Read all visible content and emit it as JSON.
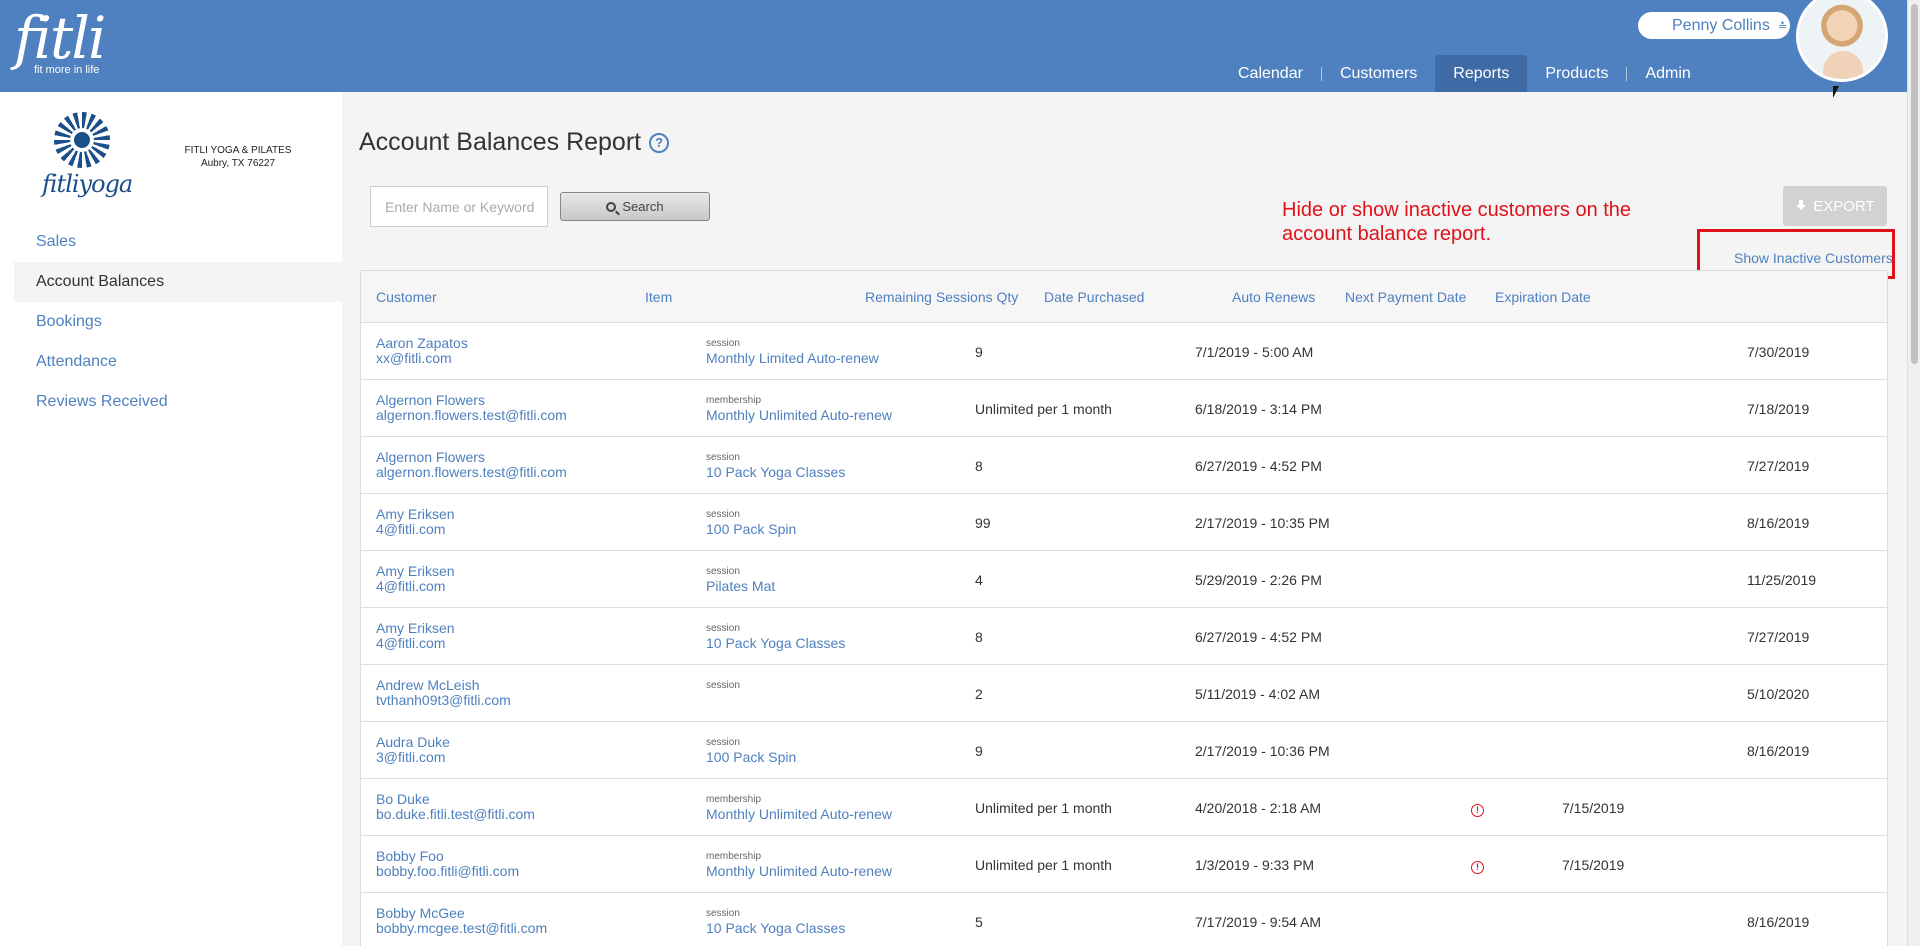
{
  "header": {
    "logo_text": "fitli",
    "logo_tagline": "fit more in life",
    "user_name": "Penny Collins",
    "nav": [
      {
        "label": "Calendar",
        "active": false
      },
      {
        "label": "Customers",
        "active": false
      },
      {
        "label": "Reports",
        "active": true
      },
      {
        "label": "Products",
        "active": false
      },
      {
        "label": "Admin",
        "active": false
      }
    ]
  },
  "sidebar": {
    "logo_text": "fitliyoga",
    "business_name": "FITLI YOGA & PILATES",
    "business_location": "Aubry, TX 76227",
    "items": [
      {
        "label": "Sales",
        "active": false
      },
      {
        "label": "Account Balances",
        "active": true
      },
      {
        "label": "Bookings",
        "active": false
      },
      {
        "label": "Attendance",
        "active": false
      },
      {
        "label": "Reviews Received",
        "active": false
      }
    ]
  },
  "main": {
    "title": "Account Balances Report",
    "help_glyph": "?",
    "search_placeholder": "Enter Name or Keyword",
    "search_label": "Search",
    "export_label": "EXPORT",
    "annotation": "Hide or show inactive customers on the account balance report.",
    "show_inactive_label": "Show Inactive Customers"
  },
  "table": {
    "columns": [
      "Customer",
      "Item",
      "Remaining Sessions Qty",
      "Date Purchased",
      "Auto Renews",
      "Next Payment Date",
      "Expiration Date"
    ],
    "rows": [
      {
        "name": "Aaron Zapatos",
        "email": "xx@fitli.com",
        "item_type": "session",
        "item_name": "Monthly Limited Auto-renew",
        "qty": "9",
        "date": "7/1/2019 - 5:00 AM",
        "auto_renew_warning": false,
        "next_payment": "",
        "expiration": "7/30/2019"
      },
      {
        "name": "Algernon Flowers",
        "email": "algernon.flowers.test@fitli.com",
        "item_type": "membership",
        "item_name": "Monthly Unlimited Auto-renew",
        "qty": "Unlimited per 1 month",
        "date": "6/18/2019 - 3:14 PM",
        "auto_renew_warning": false,
        "next_payment": "",
        "expiration": "7/18/2019"
      },
      {
        "name": "Algernon Flowers",
        "email": "algernon.flowers.test@fitli.com",
        "item_type": "session",
        "item_name": "10 Pack Yoga Classes",
        "qty": "8",
        "date": "6/27/2019 - 4:52 PM",
        "auto_renew_warning": false,
        "next_payment": "",
        "expiration": "7/27/2019"
      },
      {
        "name": "Amy Eriksen",
        "email": "4@fitli.com",
        "item_type": "session",
        "item_name": "100 Pack Spin",
        "qty": "99",
        "date": "2/17/2019 - 10:35 PM",
        "auto_renew_warning": false,
        "next_payment": "",
        "expiration": "8/16/2019"
      },
      {
        "name": "Amy Eriksen",
        "email": "4@fitli.com",
        "item_type": "session",
        "item_name": "Pilates Mat",
        "qty": "4",
        "date": "5/29/2019 - 2:26 PM",
        "auto_renew_warning": false,
        "next_payment": "",
        "expiration": "11/25/2019"
      },
      {
        "name": "Amy Eriksen",
        "email": "4@fitli.com",
        "item_type": "session",
        "item_name": "10 Pack Yoga Classes",
        "qty": "8",
        "date": "6/27/2019 - 4:52 PM",
        "auto_renew_warning": false,
        "next_payment": "",
        "expiration": "7/27/2019"
      },
      {
        "name": "Andrew McLeish",
        "email": "tvthanh09t3@fitli.com",
        "item_type": "session",
        "item_name": "",
        "qty": "2",
        "date": "5/11/2019 - 4:02 AM",
        "auto_renew_warning": false,
        "next_payment": "",
        "expiration": "5/10/2020"
      },
      {
        "name": "Audra Duke",
        "email": "3@fitli.com",
        "item_type": "session",
        "item_name": "100 Pack Spin",
        "qty": "9",
        "date": "2/17/2019 - 10:36 PM",
        "auto_renew_warning": false,
        "next_payment": "",
        "expiration": "8/16/2019"
      },
      {
        "name": "Bo Duke",
        "email": "bo.duke.fitli.test@fitli.com",
        "item_type": "membership",
        "item_name": "Monthly Unlimited Auto-renew",
        "qty": "Unlimited per 1 month",
        "date": "4/20/2018 - 2:18 AM",
        "auto_renew_warning": true,
        "next_payment": "7/15/2019",
        "expiration": ""
      },
      {
        "name": "Bobby Foo",
        "email": "bobby.foo.fitli@fitli.com",
        "item_type": "membership",
        "item_name": "Monthly Unlimited Auto-renew",
        "qty": "Unlimited per 1 month",
        "date": "1/3/2019 - 9:33 PM",
        "auto_renew_warning": true,
        "next_payment": "7/15/2019",
        "expiration": ""
      },
      {
        "name": "Bobby McGee",
        "email": "bobby.mcgee.test@fitli.com",
        "item_type": "session",
        "item_name": "10 Pack Yoga Classes",
        "qty": "5",
        "date": "7/17/2019 - 9:54 AM",
        "auto_renew_warning": false,
        "next_payment": "",
        "expiration": "8/16/2019"
      }
    ]
  },
  "colors": {
    "header_bg": "#4f80bf",
    "link": "#4f80bf",
    "annotation": "#e0111a"
  }
}
